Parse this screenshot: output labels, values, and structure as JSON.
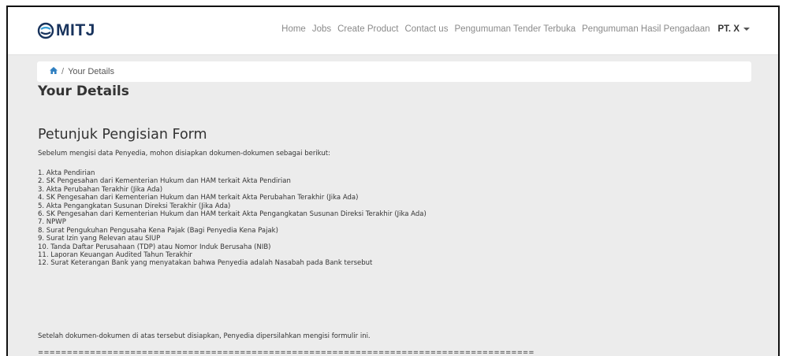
{
  "brand": {
    "logo_text": "MITJ"
  },
  "nav": {
    "items": [
      "Home",
      "Jobs",
      "Create Product",
      "Contact us",
      "Pengumuman Tender Terbuka",
      "Pengumuman Hasil Pengadaan"
    ],
    "user": "PT. X"
  },
  "breadcrumb": {
    "current": "Your Details"
  },
  "page": {
    "title": "Your Details",
    "section_title": "Petunjuk Pengisian Form",
    "intro": "Sebelum mengisi data Penyedia, mohon disiapkan dokumen-dokumen sebagai berikut:",
    "documents": [
      "1. Akta Pendirian",
      "2. SK Pengesahan dari Kementerian Hukum dan HAM terkait Akta Pendirian",
      "3. Akta Perubahan Terakhir (Jika Ada)",
      "4. SK Pengesahan dari Kementerian Hukum dan HAM terkait Akta Perubahan Terakhir (Jika Ada)",
      "5. Akta Pengangkatan Susunan Direksi Terakhir (Jika Ada)",
      "6. SK Pengesahan dari Kementerian Hukum dan HAM terkait Akta Pengangkatan Susunan Direksi Terakhir (Jika Ada)",
      "7. NPWP",
      "8. Surat Pengukuhan Pengusaha Kena Pajak (Bagi Penyedia Kena Pajak)",
      "9. Surat Izin yang Relevan atau SIUP",
      "10. Tanda Daftar Perusahaan (TDP) atau Nomor Induk Berusaha (NIB)",
      "11. Laporan Keuangan Audited Tahun Terakhir",
      "12. Surat Keterangan Bank yang menyatakan bahwa Penyedia adalah Nasabah pada Bank tersebut"
    ],
    "closing": "Setelah dokumen-dokumen di atas tersebut disiapkan, Penyedia dipersilahkan mengisi formulir ini.",
    "divider": "======================================================================================"
  },
  "colors": {
    "brand": "#17325c",
    "page_bg": "#ececec",
    "nav_text": "#8a8a8a"
  },
  "icons": {
    "logo": "swirl-logo-icon",
    "breadcrumb_home": "home-icon",
    "user_menu": "caret-down-icon"
  }
}
